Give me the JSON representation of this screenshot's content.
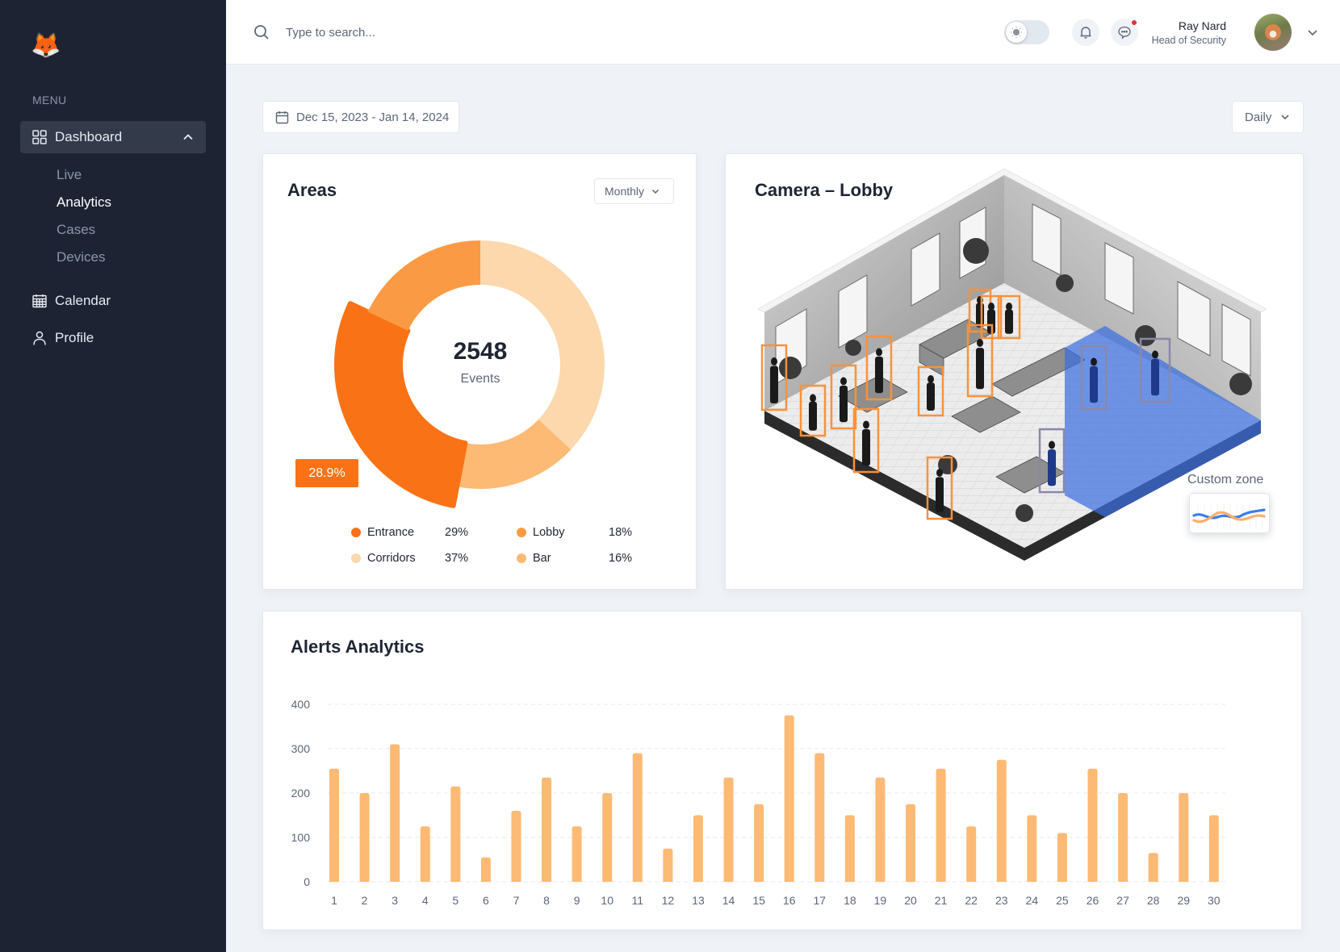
{
  "sidebar": {
    "logo_icon": "🦊",
    "menu_label": "MENU",
    "items": [
      {
        "label": "Dashboard",
        "icon": "grid-icon",
        "expanded": true,
        "children": [
          {
            "label": "Live",
            "active": false
          },
          {
            "label": "Analytics",
            "active": true
          },
          {
            "label": "Cases",
            "active": false
          },
          {
            "label": "Devices",
            "active": false
          }
        ]
      },
      {
        "label": "Calendar",
        "icon": "calendar-icon"
      },
      {
        "label": "Profile",
        "icon": "user-icon"
      }
    ]
  },
  "header": {
    "search_placeholder": "Type to search...",
    "theme_toggle": "light",
    "messages_unread": true,
    "user": {
      "name": "Ray Nard",
      "role": "Head of Security"
    }
  },
  "toolbar": {
    "date_range": "Dec 15, 2023 - Jan 14, 2024",
    "granularity": "Daily"
  },
  "areas": {
    "title": "Areas",
    "period": "Monthly",
    "total": "2548",
    "total_label": "Events",
    "highlight_badge": "28.9%",
    "legend": [
      {
        "name": "Entrance",
        "value": "29%",
        "color": "#f97316"
      },
      {
        "name": "Lobby",
        "value": "18%",
        "color": "#fb9a44"
      },
      {
        "name": "Corridors",
        "value": "37%",
        "color": "#fdd8ad"
      },
      {
        "name": "Bar",
        "value": "16%",
        "color": "#fdba74"
      }
    ]
  },
  "camera": {
    "title": "Camera – Lobby",
    "zone_label": "Custom zone",
    "detection_color": "#f7923a",
    "zone_color": "#3b6fe0"
  },
  "alerts": {
    "title": "Alerts Analytics"
  },
  "chart_data": [
    {
      "type": "pie",
      "title": "Areas",
      "categories": [
        "Corridors",
        "Bar",
        "Entrance",
        "Lobby"
      ],
      "values": [
        37,
        16,
        29,
        18
      ],
      "colors": [
        "#fdd8ad",
        "#fdba74",
        "#f97316",
        "#fb9a44"
      ],
      "highlighted": "Entrance",
      "center_text": "2548 Events"
    },
    {
      "type": "bar",
      "title": "Alerts Analytics",
      "categories": [
        "1",
        "2",
        "3",
        "4",
        "5",
        "6",
        "7",
        "8",
        "9",
        "10",
        "11",
        "12",
        "13",
        "14",
        "15",
        "16",
        "17",
        "18",
        "19",
        "20",
        "21",
        "22",
        "23",
        "24",
        "25",
        "26",
        "27",
        "28",
        "29",
        "30"
      ],
      "values": [
        255,
        200,
        310,
        125,
        215,
        55,
        160,
        235,
        125,
        200,
        290,
        75,
        150,
        235,
        175,
        375,
        290,
        150,
        235,
        175,
        255,
        125,
        275,
        150,
        110,
        255,
        200,
        65,
        200,
        150
      ],
      "xlabel": "",
      "ylabel": "",
      "ylim": [
        0,
        400
      ],
      "yticks": [
        0,
        100,
        200,
        300,
        400
      ],
      "grid": true,
      "color": "#fdba74"
    }
  ]
}
